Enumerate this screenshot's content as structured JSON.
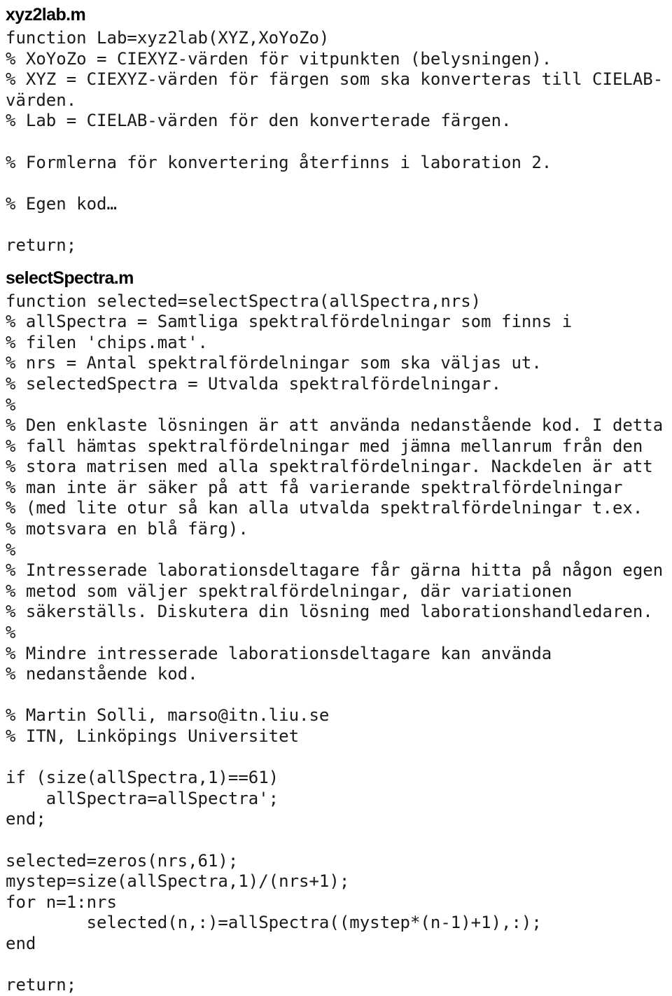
{
  "document": {
    "type": "matlab-source-listing",
    "background_color": "#ffffff",
    "text_color": "#1a1a1a",
    "sections": [
      {
        "heading": "xyz2lab.m",
        "lines": [
          "function Lab=xyz2lab(XYZ,XoYoZo)",
          "% XoYoZo = CIEXYZ-värden för vitpunkten (belysningen).",
          "% XYZ = CIEXYZ-värden för färgen som ska konverteras till CIELAB-",
          "värden.",
          "% Lab = CIELAB-värden för den konverterade färgen.",
          "",
          "% Formlerna för konvertering återfinns i laboration 2.",
          "",
          "% Egen kod…",
          "",
          "return;"
        ]
      },
      {
        "heading": "selectSpectra.m",
        "lines": [
          "function selected=selectSpectra(allSpectra,nrs)",
          "% allSpectra = Samtliga spektralfördelningar som finns i",
          "% filen 'chips.mat'.",
          "% nrs = Antal spektralfördelningar som ska väljas ut.",
          "% selectedSpectra = Utvalda spektralfördelningar.",
          "%",
          "% Den enklaste lösningen är att använda nedanstående kod. I detta",
          "% fall hämtas spektralfördelningar med jämna mellanrum från den",
          "% stora matrisen med alla spektralfördelningar. Nackdelen är att",
          "% man inte är säker på att få varierande spektralfördelningar",
          "% (med lite otur så kan alla utvalda spektralfördelningar t.ex.",
          "% motsvara en blå färg).",
          "%",
          "% Intresserade laborationsdeltagare får gärna hitta på någon egen",
          "% metod som väljer spektralfördelningar, där variationen",
          "% säkerställs. Diskutera din lösning med laborationshandledaren.",
          "%",
          "% Mindre intresserade laborationsdeltagare kan använda",
          "% nedanstående kod.",
          "",
          "% Martin Solli, marso@itn.liu.se",
          "% ITN, Linköpings Universitet",
          "",
          "if (size(allSpectra,1)==61)",
          "    allSpectra=allSpectra';",
          "end;",
          "",
          "selected=zeros(nrs,61);",
          "mystep=size(allSpectra,1)/(nrs+1);",
          "for n=1:nrs",
          "        selected(n,:)=allSpectra((mystep*(n-1)+1),:);",
          "end",
          "",
          "return;"
        ]
      }
    ]
  }
}
